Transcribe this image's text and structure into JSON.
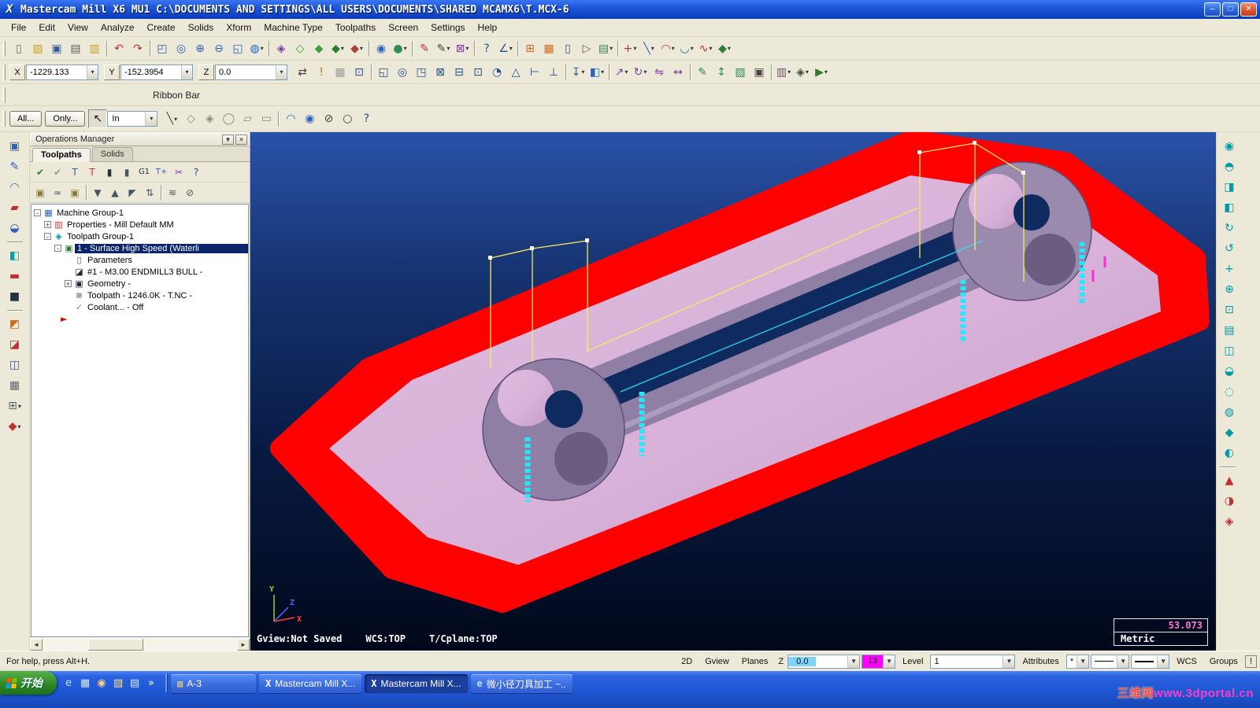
{
  "titlebar": {
    "icon_glyph": "X",
    "title": "Mastercam Mill X6 MU1  C:\\DOCUMENTS AND SETTINGS\\ALL USERS\\DOCUMENTS\\SHARED MCAMX6\\T.MCX-6",
    "window_buttons": [
      {
        "n": "minimize-button",
        "g": "–"
      },
      {
        "n": "restore-button",
        "g": "□"
      },
      {
        "n": "close-button",
        "g": "✕",
        "close": true
      }
    ]
  },
  "menubar": {
    "items": [
      "File",
      "Edit",
      "View",
      "Analyze",
      "Create",
      "Solids",
      "Xform",
      "Machine Type",
      "Toolpaths",
      "Screen",
      "Settings",
      "Help"
    ]
  },
  "toolbar_main": [
    {
      "n": "new-file",
      "g": "▯",
      "c": "#6b6b6b"
    },
    {
      "n": "open-file",
      "g": "▨",
      "c": "#c9a227"
    },
    {
      "n": "save-file",
      "g": "▣",
      "c": "#35589e"
    },
    {
      "n": "print",
      "g": "▤",
      "c": "#5a5a5a"
    },
    {
      "n": "import-directory",
      "g": "▥",
      "c": "#c9a227"
    },
    {
      "sep": true
    },
    {
      "n": "undo",
      "g": "↶",
      "c": "#c03030"
    },
    {
      "n": "redo",
      "g": "↷",
      "c": "#c03030"
    },
    {
      "sep": true
    },
    {
      "n": "zoom-window",
      "g": "◰",
      "c": "#2f62b8"
    },
    {
      "n": "zoom-target",
      "g": "◎",
      "c": "#2f62b8"
    },
    {
      "n": "zoom-in",
      "g": "⊕",
      "c": "#2f62b8"
    },
    {
      "n": "zoom-out",
      "g": "⊖",
      "c": "#2f62b8"
    },
    {
      "n": "zoom-fit",
      "g": "◱",
      "c": "#2f62b8"
    },
    {
      "n": "zoom-previous",
      "g": "◍",
      "c": "#2f62b8",
      "dd": true
    },
    {
      "sep": true
    },
    {
      "n": "repaint",
      "g": "◈",
      "c": "#7a3fa0"
    },
    {
      "n": "wireframe-view",
      "g": "◇",
      "c": "#3f9e3f"
    },
    {
      "n": "shaded-view",
      "g": "◆",
      "c": "#3f9e3f"
    },
    {
      "n": "shaded-edges-view",
      "g": "◆",
      "c": "#2e7d32",
      "dd": true
    },
    {
      "n": "rendered-view",
      "g": "◆",
      "c": "#b23b3b",
      "dd": true
    },
    {
      "sep": true
    },
    {
      "n": "analyze-position",
      "g": "◉",
      "c": "#2f62b8"
    },
    {
      "n": "analyze-dynamic",
      "g": "●",
      "c": "#2e8b57",
      "dd": true
    },
    {
      "sep": true
    },
    {
      "n": "delete-entities",
      "g": "✎",
      "c": "#c03030"
    },
    {
      "n": "delete-options",
      "g": "✎",
      "c": "#444444",
      "dd": true
    },
    {
      "n": "undelete",
      "g": "⊠",
      "c": "#7a3fa0",
      "dd": true
    },
    {
      "sep": true
    },
    {
      "n": "analyze-distance",
      "g": "?",
      "c": "#28508e"
    },
    {
      "n": "analyze-angle",
      "g": "∠",
      "c": "#28508e",
      "dd": true
    },
    {
      "sep": true
    },
    {
      "n": "viewsheet-grid",
      "g": "⊞",
      "c": "#d2691e"
    },
    {
      "n": "viewsheet-table",
      "g": "▦",
      "c": "#d2691e"
    },
    {
      "n": "nc-file",
      "g": "▯",
      "c": "#28508e"
    },
    {
      "n": "send-file",
      "g": "▷",
      "c": "#5a5a5a"
    },
    {
      "n": "level-manager",
      "g": "▤",
      "c": "#2e8b57",
      "dd": true
    },
    {
      "sep": true
    },
    {
      "n": "create-point",
      "g": "+",
      "c": "#c03030",
      "dd": true
    },
    {
      "n": "create-line",
      "g": "╲",
      "c": "#2f62b8",
      "dd": true
    },
    {
      "n": "create-arc",
      "g": "◠",
      "c": "#c03030",
      "dd": true
    },
    {
      "n": "create-fillet",
      "g": "◡",
      "c": "#2f62b8",
      "dd": true
    },
    {
      "n": "create-spline",
      "g": "∿",
      "c": "#c03030",
      "dd": true
    },
    {
      "n": "create-solid",
      "g": "◆",
      "c": "#2e7d32",
      "dd": true
    }
  ],
  "coords": {
    "x_label": "X",
    "x_value": "-1229.133",
    "y_label": "Y",
    "y_value": "-152.3954",
    "z_label": "Z",
    "z_value": "0.0"
  },
  "toolbar_secondary": [
    {
      "n": "gview-sync",
      "g": "⇄",
      "c": "#444444"
    },
    {
      "n": "prompt-alert",
      "g": "!",
      "c": "#d2691e"
    },
    {
      "n": "fastpoint-grid",
      "g": "▦",
      "c": "#9a9a9a"
    },
    {
      "n": "autocursor-config",
      "g": "⊡",
      "c": "#28508e"
    },
    {
      "sep": true
    },
    {
      "n": "snap-origin",
      "g": "◱",
      "c": "#28508e"
    },
    {
      "n": "snap-arc-center",
      "g": "◎",
      "c": "#28508e"
    },
    {
      "n": "snap-endpoint",
      "g": "◳",
      "c": "#28508e"
    },
    {
      "n": "snap-intersection",
      "g": "⊠",
      "c": "#28508e"
    },
    {
      "n": "snap-midpoint",
      "g": "⊟",
      "c": "#28508e"
    },
    {
      "n": "snap-point",
      "g": "⊡",
      "c": "#28508e"
    },
    {
      "n": "snap-quadrant",
      "g": "◔",
      "c": "#28508e"
    },
    {
      "n": "snap-face",
      "g": "△",
      "c": "#28508e"
    },
    {
      "n": "snap-horizontal",
      "g": "⊢",
      "c": "#28508e"
    },
    {
      "n": "snap-vertical",
      "g": "⊥",
      "c": "#28508e"
    },
    {
      "sep": true
    },
    {
      "n": "depth-selector",
      "g": "↧",
      "c": "#2f62b8",
      "dd": true
    },
    {
      "n": "plane-selector",
      "g": "◧",
      "c": "#2f62b8",
      "dd": true
    },
    {
      "sep": true
    },
    {
      "n": "xform-translate",
      "g": "↗",
      "c": "#7a3fa0",
      "dd": true
    },
    {
      "n": "xform-rotate",
      "g": "↻",
      "c": "#7a3fa0",
      "dd": true
    },
    {
      "n": "xform-mirror",
      "g": "⇋",
      "c": "#7a3fa0"
    },
    {
      "n": "xform-scale",
      "g": "↔",
      "c": "#7a3fa0"
    },
    {
      "sep": true
    },
    {
      "n": "drafting-note",
      "g": "✎",
      "c": "#2e8b57"
    },
    {
      "n": "drafting-dimension",
      "g": "↕",
      "c": "#2e8b57"
    },
    {
      "n": "drafting-hatch",
      "g": "▨",
      "c": "#2e8b57"
    },
    {
      "n": "screen-capture",
      "g": "▣",
      "c": "#444444"
    },
    {
      "sep": true
    },
    {
      "n": "solids-history",
      "g": "▥",
      "c": "#7a3fa0",
      "dd": true
    },
    {
      "n": "machine-sim",
      "g": "◈",
      "c": "#444444",
      "dd": true
    },
    {
      "n": "post-process",
      "g": "▶",
      "c": "#2e7d32",
      "dd": true
    }
  ],
  "ribbon": {
    "label": "Ribbon Bar"
  },
  "filter_bar": {
    "all_label": "All...",
    "only_label": "Only...",
    "cursor_glyph": "↖",
    "units_value": "In",
    "icons": [
      {
        "n": "chain-line",
        "g": "╲",
        "c": "#444444",
        "dd": true
      },
      {
        "n": "select-polygon",
        "g": "◇",
        "c": "#8a8a8a"
      },
      {
        "n": "select-hexagon",
        "g": "◈",
        "c": "#8a8a8a"
      },
      {
        "n": "select-circle",
        "g": "◯",
        "c": "#8a8a8a"
      },
      {
        "n": "select-shape",
        "g": "▱",
        "c": "#8a8a8a"
      },
      {
        "n": "select-window",
        "g": "▭",
        "c": "#8a8a8a"
      },
      {
        "sep": true
      },
      {
        "n": "select-arc-mode",
        "g": "◠",
        "c": "#2f62b8"
      },
      {
        "n": "select-validate",
        "g": "◉",
        "c": "#2f62b8"
      },
      {
        "n": "select-none",
        "g": "⊘",
        "c": "#444444"
      },
      {
        "n": "select-last",
        "g": "○",
        "c": "#444444"
      },
      {
        "n": "selection-help",
        "g": "?",
        "c": "#28508e"
      }
    ]
  },
  "left_toolbar": [
    {
      "n": "analyze-tool",
      "g": "▣",
      "c": "#2f62b8"
    },
    {
      "n": "sketch-tool",
      "g": "✎",
      "c": "#2f62b8"
    },
    {
      "n": "arc-tool",
      "g": "◠",
      "c": "#2f62b8"
    },
    {
      "n": "erase-tool",
      "g": "▰",
      "c": "#c03030"
    },
    {
      "n": "surface-tool",
      "g": "◒",
      "c": "#2f62b8"
    },
    {
      "sep": true
    },
    {
      "n": "drafting-tool",
      "g": "◧",
      "c": "#00a0b0"
    },
    {
      "n": "line-tool",
      "g": "▬",
      "c": "#c03030"
    },
    {
      "n": "solid-tool",
      "g": "■",
      "c": "#223344"
    },
    {
      "sep": true
    },
    {
      "n": "xform-panel",
      "g": "◩",
      "c": "#d2691e"
    },
    {
      "n": "machine-panel",
      "g": "◪",
      "c": "#c03030"
    },
    {
      "n": "toolpath-panel",
      "g": "◫",
      "c": "#2f62b8"
    },
    {
      "n": "grid-panel",
      "g": "▦",
      "c": "#556677"
    },
    {
      "n": "screen-panel",
      "g": "⊞",
      "c": "#556677",
      "dd": true
    },
    {
      "n": "extras-panel",
      "g": "◆",
      "c": "#c03030",
      "dd": true
    }
  ],
  "right_toolbar": [
    {
      "n": "gview-isometric",
      "g": "◉",
      "c": "#0097a7"
    },
    {
      "n": "gview-top",
      "g": "◓",
      "c": "#0097a7"
    },
    {
      "n": "gview-front",
      "g": "◨",
      "c": "#0097a7"
    },
    {
      "n": "gview-right",
      "g": "◧",
      "c": "#0097a7"
    },
    {
      "n": "rotate-view",
      "g": "↻",
      "c": "#0097a7"
    },
    {
      "n": "spin-view",
      "g": "↺",
      "c": "#0097a7"
    },
    {
      "n": "pan-view",
      "g": "+",
      "c": "#0097a7"
    },
    {
      "n": "zoom-view",
      "g": "⊕",
      "c": "#0097a7"
    },
    {
      "n": "fit-view",
      "g": "⊡",
      "c": "#0097a7"
    },
    {
      "n": "named-views",
      "g": "▤",
      "c": "#0097a7"
    },
    {
      "n": "viewports",
      "g": "◫",
      "c": "#0097a7"
    },
    {
      "n": "section-view",
      "g": "◒",
      "c": "#0097a7"
    },
    {
      "n": "hide-entities",
      "g": "◌",
      "c": "#0097a7"
    },
    {
      "n": "unhide-entities",
      "g": "◍",
      "c": "#0097a7"
    },
    {
      "n": "shading-toggle",
      "g": "◆",
      "c": "#0097a7"
    },
    {
      "n": "translucency-toggle",
      "g": "◐",
      "c": "#0097a7"
    },
    {
      "sep": true
    },
    {
      "n": "normals-toggle",
      "g": "▲",
      "c": "#c03030"
    },
    {
      "n": "backfaces-toggle",
      "g": "◑",
      "c": "#c03030"
    },
    {
      "n": "regen-display",
      "g": "◈",
      "c": "#c03030"
    }
  ],
  "ops_manager": {
    "title": "Operations Manager",
    "menu_glyph": "▼",
    "close_glyph": "✕",
    "tabs": [
      "Toolpaths",
      "Solids"
    ],
    "toolbar1": [
      {
        "n": "select-all-ops",
        "g": "✔",
        "c": "#2e7d32"
      },
      {
        "n": "select-dirty-ops",
        "g": "✔",
        "c": "#999999"
      },
      {
        "n": "regen-selected",
        "g": "T",
        "c": "#2f62b8"
      },
      {
        "n": "regen-dirty",
        "g": "T",
        "c": "#c03030"
      },
      {
        "n": "backplot",
        "g": "▮",
        "c": "#223344"
      },
      {
        "n": "verify",
        "g": "▮",
        "c": "#445566"
      },
      {
        "n": "post-selected",
        "g": "G1",
        "c": "#223344"
      },
      {
        "n": "high-feed",
        "g": "T+",
        "c": "#2f62b8"
      },
      {
        "n": "delete-operations",
        "g": "✂",
        "c": "#7a3fa0"
      },
      {
        "n": "ops-help",
        "g": "?",
        "c": "#28508e"
      }
    ],
    "toolbar2": [
      {
        "n": "lock-selected",
        "g": "▣",
        "c": "#8a7a3a"
      },
      {
        "n": "toggle-toolpath-display",
        "g": "≈",
        "c": "#445566"
      },
      {
        "n": "lock-all",
        "g": "▣",
        "c": "#8a7a3a"
      },
      {
        "sep": true
      },
      {
        "n": "move-insert-down",
        "g": "▼",
        "c": "#445566"
      },
      {
        "n": "move-insert-up",
        "g": "▲",
        "c": "#445566"
      },
      {
        "n": "insert-above",
        "g": "◤",
        "c": "#445566"
      },
      {
        "n": "scroll-to-insert",
        "g": "⇅",
        "c": "#445566"
      },
      {
        "sep": true
      },
      {
        "n": "display-only-selected",
        "g": "≋",
        "c": "#445566"
      },
      {
        "n": "disable-posting",
        "g": "⊘",
        "c": "#445566"
      }
    ],
    "tree": [
      {
        "id": "machine-group-1",
        "level": 0,
        "exp": "-",
        "g": "▦",
        "c": "#2f62b8",
        "label": "Machine Group-1"
      },
      {
        "id": "properties",
        "level": 1,
        "exp": "+",
        "g": "▥",
        "c": "#c03030",
        "label": "Properties - Mill Default MM"
      },
      {
        "id": "toolpath-group-1",
        "level": 1,
        "exp": "-",
        "g": "◈",
        "c": "#0097a7",
        "label": "Toolpath Group-1"
      },
      {
        "id": "operation-1",
        "level": 2,
        "exp": "-",
        "g": "▣",
        "c": "#2e7d32",
        "label": "1 - Surface High Speed (Waterli",
        "selected": true
      },
      {
        "id": "parameters",
        "level": 3,
        "g": "▯",
        "c": "#44506a",
        "label": "Parameters"
      },
      {
        "id": "tool-definition",
        "level": 3,
        "g": "◪",
        "c": "#222a3a",
        "label": "#1 - M3.00 ENDMILL3 BULL -"
      },
      {
        "id": "geometry",
        "level": 3,
        "exp": "+",
        "g": "▣",
        "c": "#222a3a",
        "label": "Geometry -"
      },
      {
        "id": "toolpath-file",
        "level": 3,
        "g": "≋",
        "c": "#28508e",
        "label": "Toolpath - 1246.0K - T.NC -"
      },
      {
        "id": "coolant",
        "level": 3,
        "g": "✓",
        "c": "#8a8a8a",
        "label": "Coolant... - Off"
      }
    ],
    "insert_arrow_glyph": "►",
    "scroll_left_glyph": "◄",
    "scroll_right_glyph": "►"
  },
  "viewport": {
    "gview_status": "Gview:Not Saved",
    "wcs_status": "WCS:TOP",
    "tcplane_status": "T/Cplane:TOP",
    "measure_value": "53.073",
    "units": "Metric",
    "axis_x": "X",
    "axis_y": "Y",
    "axis_z": "Z",
    "colors": {
      "stock_red": "#fe0000",
      "top_pink": "#d8b2d8",
      "wall_mauve": "#8f7fa4",
      "pocket_navy": "#0e2a5e",
      "toolpath_cyan": "#23e8ff",
      "wire_yellow": "#ffe95e",
      "marker_magenta": "#ff2bd6"
    }
  },
  "statusbar": {
    "help_text": "For help, press Alt+H.",
    "btn_2d": "2D",
    "btn_gview": "Gview",
    "btn_planes": "Planes",
    "z_label": "Z",
    "z_value": "0.0",
    "color_value": "13",
    "color_hex": "#ff00ff",
    "level_label": "Level",
    "level_value": "1",
    "attributes_label": "Attributes",
    "star_value": "*",
    "wcs_label": "WCS",
    "groups_label": "Groups",
    "alert_label": "!"
  },
  "taskbar": {
    "start_label": "开始",
    "quick_launch": [
      {
        "n": "ql-ie",
        "g": "e",
        "c": "#bfe0ff"
      },
      {
        "n": "ql-desktop",
        "g": "▦",
        "c": "#d8ecff"
      },
      {
        "n": "ql-media",
        "g": "◉",
        "c": "#ffd27f"
      },
      {
        "n": "ql-folder",
        "g": "▨",
        "c": "#ffe08a"
      },
      {
        "n": "ql-notes",
        "g": "▤",
        "c": "#d8ecff"
      },
      {
        "n": "ql-more",
        "g": "»",
        "c": "#ffffff"
      }
    ],
    "tasks": [
      {
        "n": "task-a3",
        "icon_g": "▨",
        "icon_c": "#ffd54f",
        "label": "A-3",
        "active": false
      },
      {
        "n": "task-mastercam-1",
        "icon_g": "X",
        "icon_c": "#ffffff",
        "label": "Mastercam Mill X...",
        "active": false
      },
      {
        "n": "task-mastercam-2",
        "icon_g": "X",
        "icon_c": "#ffffff",
        "label": "Mastercam Mill X...",
        "active": true
      },
      {
        "n": "task-ie-doc",
        "icon_g": "e",
        "icon_c": "#bfe0ff",
        "label": "微小径刀具加工 ~..",
        "active": false
      }
    ],
    "watermark_site": "三维网",
    "watermark_url": "www.3dportal.cn"
  }
}
